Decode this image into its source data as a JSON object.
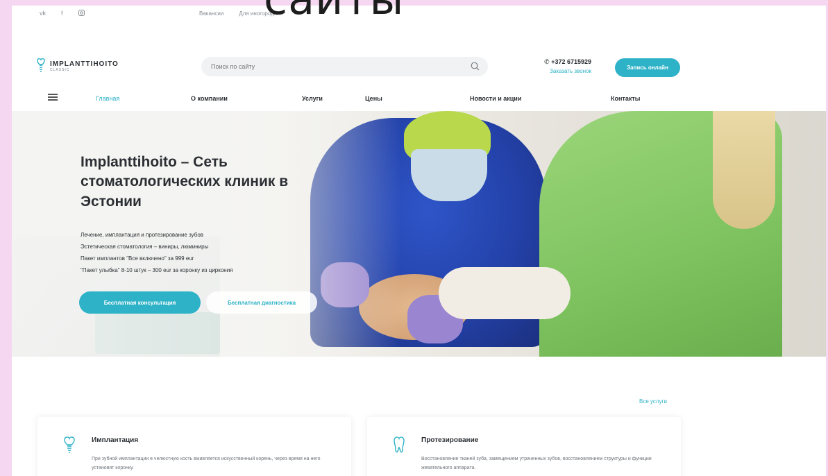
{
  "banner": {
    "text": "сайты"
  },
  "topbar": {
    "social": [
      "vk",
      "f",
      "ig"
    ],
    "links": [
      "Вакансии",
      "Для иногородних"
    ]
  },
  "header": {
    "logo_name": "IMPLANTTIHOITO",
    "logo_sub": "CLASSIC",
    "search_placeholder": "Поиск по сайту",
    "phone": "+372 6715929",
    "callback": "Заказать звонок",
    "online_button": "Запись онлайн"
  },
  "nav": {
    "items": [
      "Главная",
      "О компании",
      "Услуги",
      "Цены",
      "Новости и акции",
      "Контакты"
    ]
  },
  "hero": {
    "title": "Implanttihoito – Сеть стоматологических клиник в Эстонии",
    "lines": [
      "Лечение, имплантация и протезирование зубов",
      "Эстетическая стоматология – виниры, люминиры",
      "Пакет имплантов \"Все включено\" за 999 eur",
      "\"Пакет улыбка\" 8-10 штук – 300 eur за коронку из циркония"
    ],
    "consult_button": "Бесплатная консультация",
    "diagnostic_button": "Бесплатная диагностика"
  },
  "services": {
    "all_link": "Все услуги",
    "cards": [
      {
        "title": "Имплантация",
        "desc": "При зубной имплантации в челюстную кость вживляется искусственный корень, через время на него установят коронку."
      },
      {
        "title": "Протезирование",
        "desc": "Восстановление тканей зуба, замещением утраченных зубов, восстановлением структуры и функции жевательного аппарата."
      }
    ]
  },
  "colors": {
    "accent": "#2db2c7",
    "frame": "#f6d7f1"
  }
}
